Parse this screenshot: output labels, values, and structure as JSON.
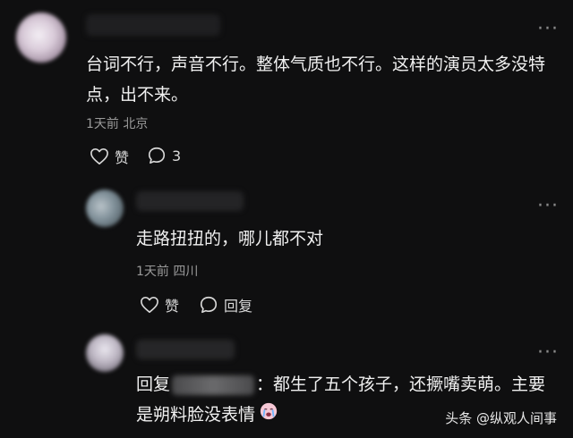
{
  "comments": [
    {
      "text": "台词不行，声音不行。整体气质也不行。这样的演员太多没特点，出不来。",
      "time": "1天前",
      "location": "北京",
      "like_label": "赞",
      "reply_count": "3"
    },
    {
      "text": "走路扭扭的，哪儿都不对",
      "time": "1天前",
      "location": "四川",
      "like_label": "赞",
      "reply_label": "回复"
    },
    {
      "prefix": "回复",
      "text": "：都生了五个孩子，还撅嘴卖萌。主要是朔料脸没表情"
    }
  ],
  "watermark": {
    "brand": "头条",
    "handle": "@纵观人间事"
  },
  "colors": {
    "background": "#0f0f10",
    "text": "#f0f0f0",
    "meta": "#9a9a9a"
  }
}
